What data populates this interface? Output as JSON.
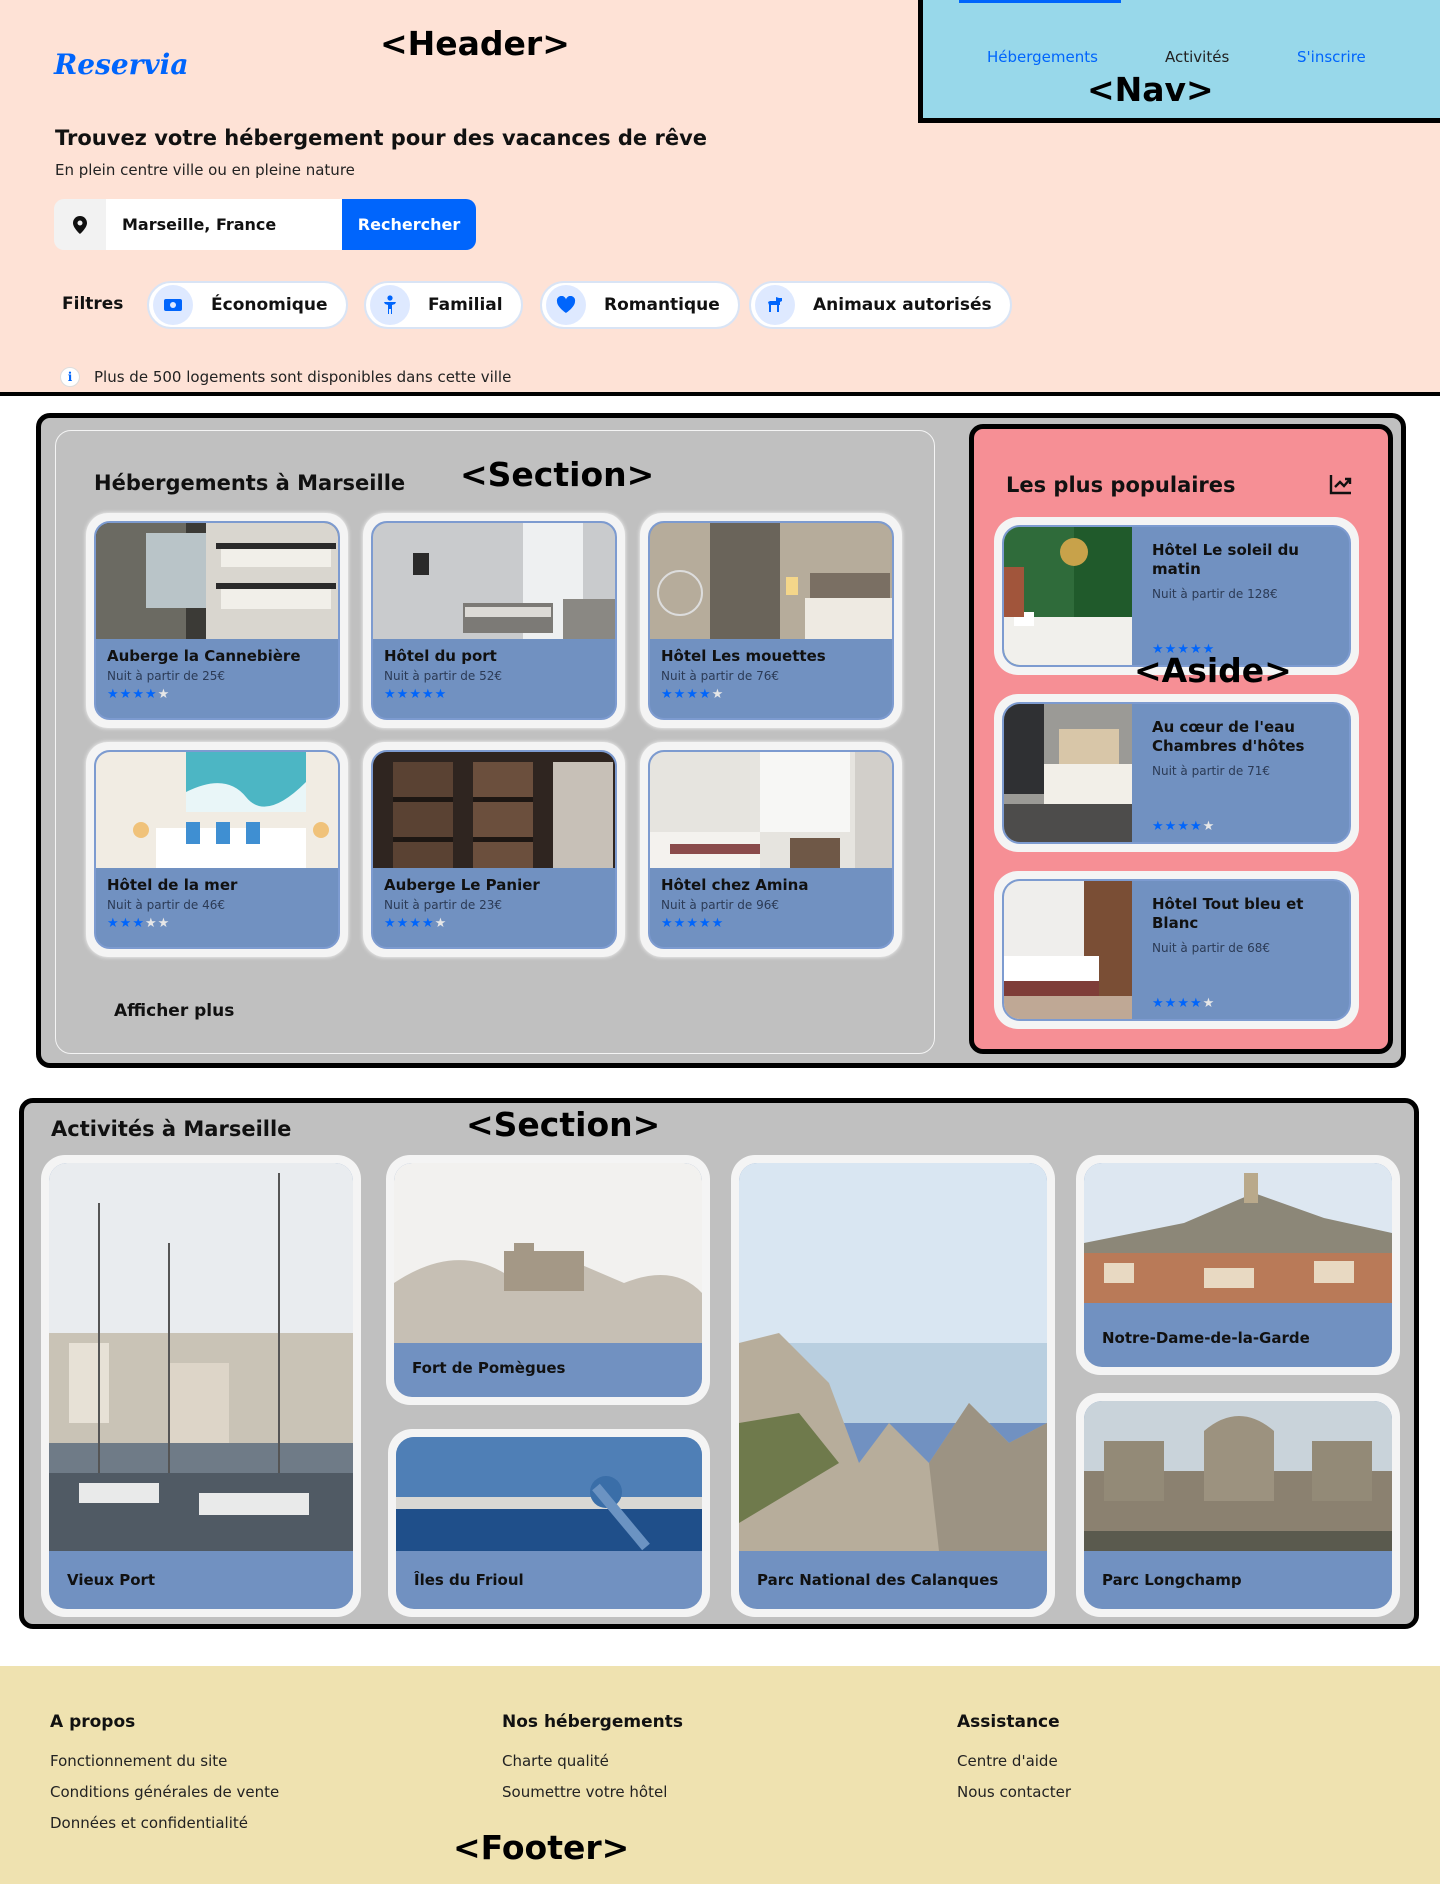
{
  "header": {
    "logo": "Reservia",
    "zone_label": "<Header>",
    "title": "Trouvez votre hébergement pour des vacances de rêve",
    "subtitle": "En plein centre ville ou en pleine nature",
    "search": {
      "value": "Marseille, France",
      "button": "Rechercher"
    },
    "filters_label": "Filtres",
    "filters": [
      {
        "label": "Économique",
        "icon": "money-icon"
      },
      {
        "label": "Familial",
        "icon": "child-icon"
      },
      {
        "label": "Romantique",
        "icon": "heart-icon"
      },
      {
        "label": "Animaux autorisés",
        "icon": "dog-icon"
      }
    ],
    "info": "Plus de 500 logements sont disponibles dans cette ville"
  },
  "nav": {
    "zone_label": "<Nav>",
    "items": [
      {
        "label": "Hébergements",
        "color": "#0065fc"
      },
      {
        "label": "Activités",
        "color": "#222222"
      },
      {
        "label": "S'inscrire",
        "color": "#0065fc"
      }
    ]
  },
  "hebergements": {
    "zone_label": "<Section>",
    "title": "Hébergements à Marseille",
    "cards": [
      {
        "name": "Auberge la Cannebière",
        "price": "Nuit à partir de 25€",
        "rating": 4
      },
      {
        "name": "Hôtel du port",
        "price": "Nuit à partir de 52€",
        "rating": 5
      },
      {
        "name": "Hôtel Les mouettes",
        "price": "Nuit à partir de 76€",
        "rating": 4
      },
      {
        "name": "Hôtel de la mer",
        "price": "Nuit à partir de 46€",
        "rating": 3
      },
      {
        "name": "Auberge Le Panier",
        "price": "Nuit à partir de 23€",
        "rating": 4
      },
      {
        "name": "Hôtel chez Amina",
        "price": "Nuit à partir de 96€",
        "rating": 5
      }
    ],
    "more": "Afficher plus"
  },
  "populaires": {
    "zone_label": "<Aside>",
    "title": "Les plus populaires",
    "icon": "trending-up-icon",
    "cards": [
      {
        "name": "Hôtel Le soleil du matin",
        "price": "Nuit à partir de 128€",
        "rating": 5
      },
      {
        "name": "Au cœur de l'eau Chambres d'hôtes",
        "price": "Nuit à partir de 71€",
        "rating": 4
      },
      {
        "name": "Hôtel Tout bleu et Blanc",
        "price": "Nuit à partir de 68€",
        "rating": 4
      }
    ]
  },
  "activites": {
    "zone_label": "<Section>",
    "title": "Activités à Marseille",
    "items": [
      {
        "label": "Vieux Port"
      },
      {
        "label": "Fort de Pomègues"
      },
      {
        "label": "Îles du Frioul"
      },
      {
        "label": "Parc National des Calanques"
      },
      {
        "label": "Notre-Dame-de-la-Garde"
      },
      {
        "label": "Parc Longchamp"
      }
    ]
  },
  "footer": {
    "zone_label": "<Footer>",
    "columns": [
      {
        "title": "A propos",
        "links": [
          "Fonctionnement du site",
          "Conditions générales de vente",
          "Données et confidentialité"
        ]
      },
      {
        "title": "Nos hébergements",
        "links": [
          "Charte qualité",
          "Soumettre votre hôtel"
        ]
      },
      {
        "title": "Assistance",
        "links": [
          "Centre d'aide",
          "Nous contacter"
        ]
      }
    ]
  },
  "colors": {
    "accent": "#0065fc",
    "header_bg": "#fee2d6",
    "nav_bg": "#98d8ea",
    "section_bg": "#c0c0c0",
    "aside_bg": "#f68f95",
    "card_body": "#7191c1",
    "footer_bg": "#efe2b0"
  }
}
